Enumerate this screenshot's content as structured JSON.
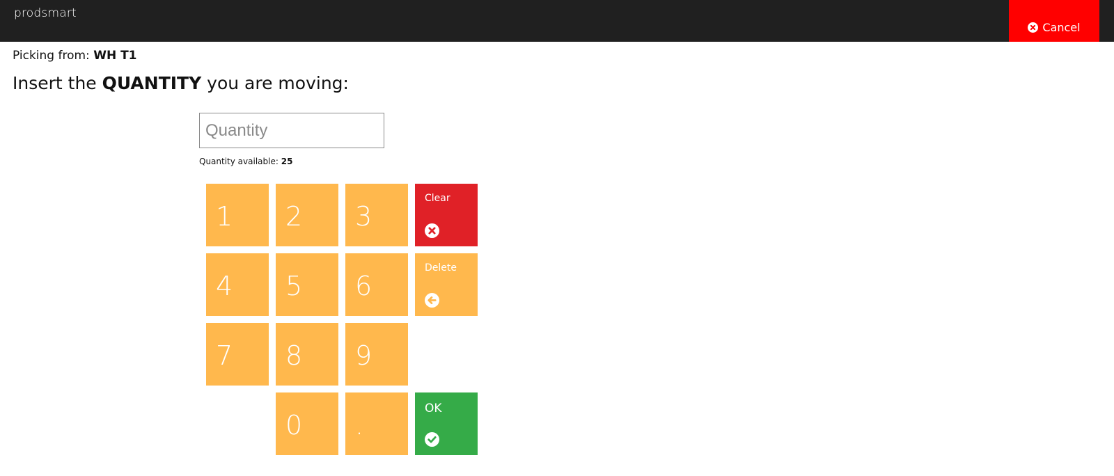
{
  "header": {
    "logo": "prodsmart",
    "cancel_label": "Cancel"
  },
  "picking": {
    "label": "Picking from:",
    "location": "WH T1"
  },
  "instruction": {
    "prefix": "Insert the",
    "emphasis": "QUANTITY",
    "suffix": "you are moving:"
  },
  "quantity_input": {
    "placeholder": "Quantity",
    "value": ""
  },
  "availability": {
    "label": "Quantity available:",
    "value": "25"
  },
  "keypad": {
    "keys": [
      "1",
      "2",
      "3",
      "4",
      "5",
      "6",
      "7",
      "8",
      "9",
      "0",
      "."
    ],
    "clear_label": "Clear",
    "delete_label": "Delete",
    "ok_label": "OK"
  },
  "colors": {
    "topbar": "#202020",
    "cancel": "#ff0000",
    "key": "#ffb84d",
    "clear": "#e02127",
    "ok": "#35ab48"
  },
  "icons": {
    "cancel": "times-circle-icon",
    "clear": "times-circle-icon",
    "delete": "arrow-left-circle-icon",
    "ok": "check-circle-icon"
  }
}
